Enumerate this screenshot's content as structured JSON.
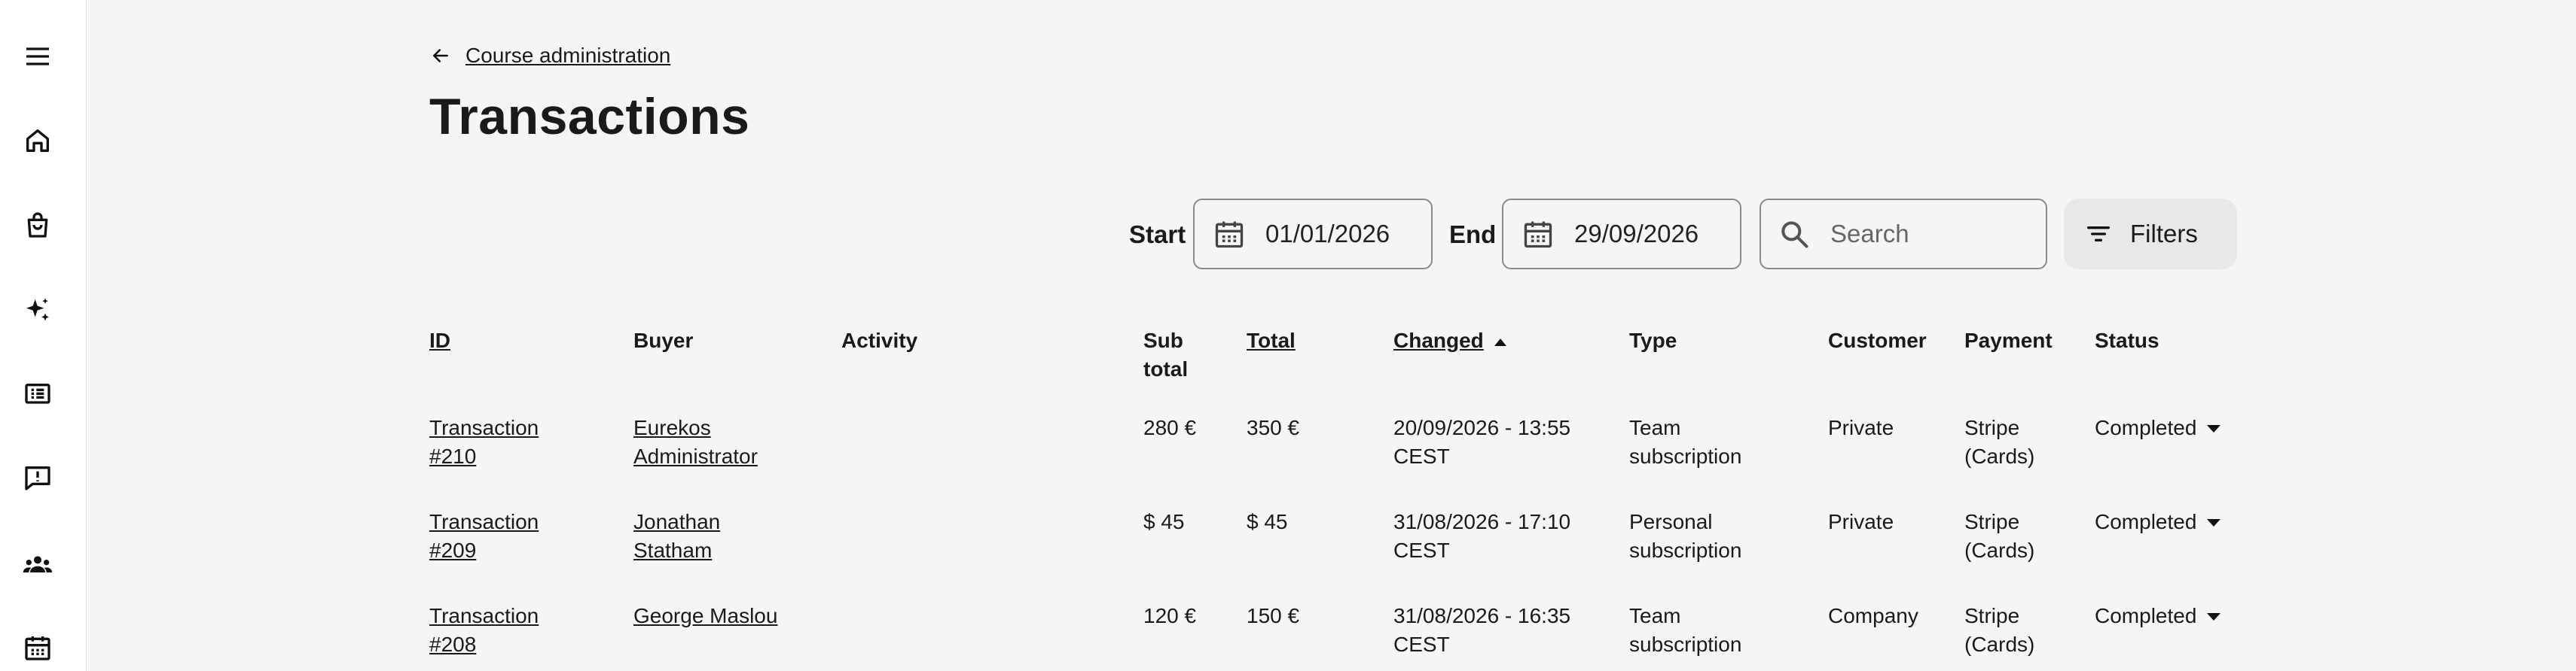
{
  "breadcrumb": {
    "back_label": "Course administration"
  },
  "page": {
    "title": "Transactions"
  },
  "filters": {
    "start_label": "Start",
    "start_value": "01/01/2026",
    "end_label": "End",
    "end_value": "29/09/2026",
    "search_placeholder": "Search",
    "filters_label": "Filters"
  },
  "sidebar": {
    "icons": [
      "menu-icon",
      "home-icon",
      "shopping-bag-icon",
      "sparkles-icon",
      "list-icon",
      "feedback-icon",
      "groups-icon",
      "calendar-icon"
    ]
  },
  "table": {
    "headers": {
      "id": "ID",
      "buyer": "Buyer",
      "activity": "Activity",
      "subtotal_1": "Sub",
      "subtotal_2": "total",
      "total": "Total",
      "changed": "Changed",
      "type": "Type",
      "customer": "Customer",
      "payment": "Payment",
      "status": "Status"
    },
    "rows": [
      {
        "id_1": "Transaction",
        "id_2": "#210",
        "buyer_1": "Eurekos",
        "buyer_2": "Administrator",
        "activity": "",
        "subtotal": "280 €",
        "total": "350 €",
        "changed_1": "20/09/2026 - 13:55",
        "changed_2": "CEST",
        "type_1": "Team",
        "type_2": "subscription",
        "customer": "Private",
        "payment_1": "Stripe",
        "payment_2": "(Cards)",
        "status": "Completed"
      },
      {
        "id_1": "Transaction",
        "id_2": "#209",
        "buyer_1": "Jonathan",
        "buyer_2": "Statham",
        "activity": "",
        "subtotal": "$ 45",
        "total": "$ 45",
        "changed_1": "31/08/2026 - 17:10",
        "changed_2": "CEST",
        "type_1": "Personal",
        "type_2": "subscription",
        "customer": "Private",
        "payment_1": "Stripe",
        "payment_2": "(Cards)",
        "status": "Completed"
      },
      {
        "id_1": "Transaction",
        "id_2": "#208",
        "buyer_1": "George Maslou",
        "buyer_2": "",
        "activity": "",
        "subtotal": "120 €",
        "total": "150 €",
        "changed_1": "31/08/2026 - 16:35",
        "changed_2": "CEST",
        "type_1": "Team",
        "type_2": "subscription",
        "customer": "Company",
        "payment_1": "Stripe",
        "payment_2": "(Cards)",
        "status": "Completed"
      }
    ]
  }
}
